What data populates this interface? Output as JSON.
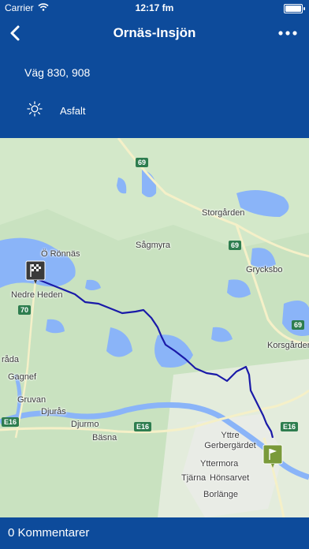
{
  "status_bar": {
    "carrier": "Carrier",
    "time": "12:17 fm"
  },
  "nav": {
    "title": "Ornäs-Insjön"
  },
  "info": {
    "road": "Väg 830, 908",
    "surface": "Asfalt"
  },
  "map": {
    "places": [
      "Ö Rönnäs",
      "Nedre Heden",
      "Storgården",
      "Sågmyra",
      "Grycksbo",
      "Korsgården",
      "Gagnef",
      "Gruvan",
      "Djurås",
      "Djurmo",
      "Bäsna",
      "Yttre Gerbergärdet",
      "Yttermora",
      "Tjärna",
      "Hönsarvet",
      "Borlänge",
      "råda"
    ],
    "road_numbers": [
      "69",
      "69",
      "69",
      "70",
      "E16",
      "E16",
      "E16"
    ],
    "start_marker": "checkered-flag-icon",
    "end_marker": "finish-flag-icon"
  },
  "footer": {
    "comments": "0 Kommentarer"
  },
  "colors": {
    "header": "#0d4b9b",
    "route": "#1a1aa8",
    "water": "#8ab4f8",
    "land": "#c9e2c0"
  }
}
